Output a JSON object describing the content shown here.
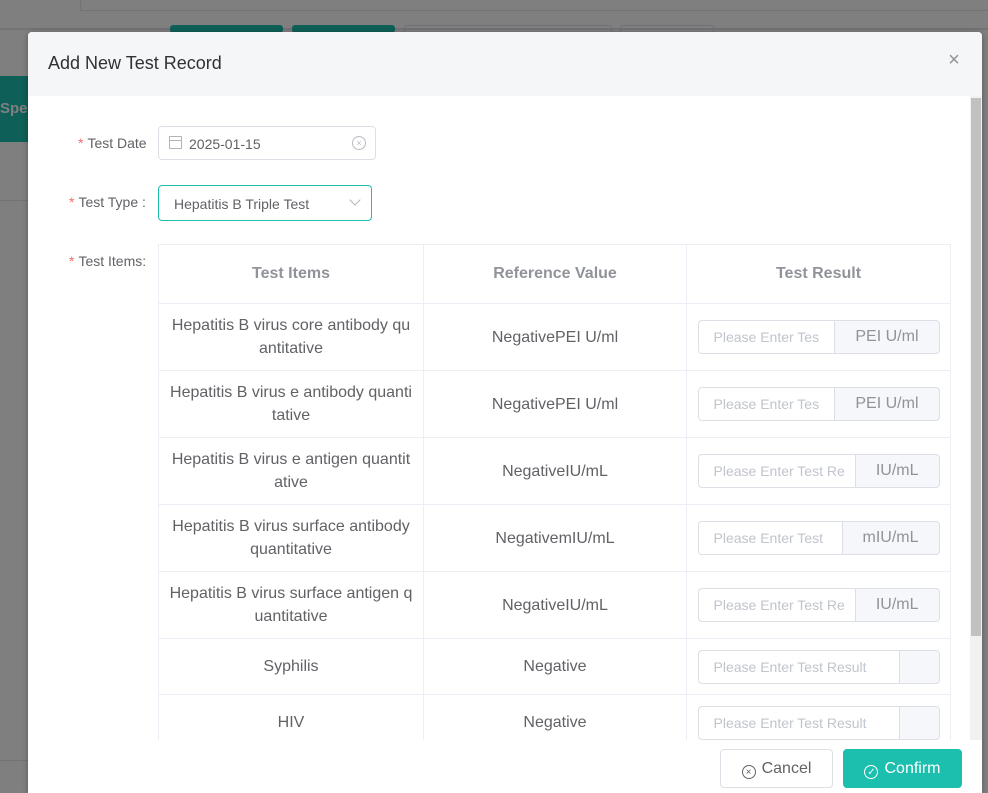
{
  "background": {
    "side_tab_label": "Spe"
  },
  "dialog": {
    "title": "Add New Test Record",
    "close_icon": "close-icon"
  },
  "form": {
    "test_date": {
      "label": "Test Date",
      "value": "2025-01-15",
      "icon": "calendar-icon",
      "clear_icon": "clear-circle-icon"
    },
    "test_type": {
      "label": "Test Type :",
      "value": "Hepatitis B Triple Test",
      "icon": "chevron-down-icon"
    },
    "test_items": {
      "label": "Test Items:",
      "columns": [
        "Test Items",
        "Reference Value",
        "Test Result"
      ],
      "rows": [
        {
          "item": "Hepatitis B virus core antibody quantitative",
          "reference": "NegativePEI U/ml",
          "placeholder": "Please Enter Tes",
          "unit": "PEI U/ml"
        },
        {
          "item": "Hepatitis B virus e antibody quantitative",
          "reference": "NegativePEI U/ml",
          "placeholder": "Please Enter Tes",
          "unit": "PEI U/ml"
        },
        {
          "item": "Hepatitis B virus e antigen quantitative",
          "reference": "NegativeIU/mL",
          "placeholder": "Please Enter Test Re",
          "unit": "IU/mL"
        },
        {
          "item": "Hepatitis B virus surface antibody quantitative",
          "reference": "NegativemIU/mL",
          "placeholder": "Please Enter Test",
          "unit": "mIU/mL"
        },
        {
          "item": "Hepatitis B virus surface antigen quantitative",
          "reference": "NegativeIU/mL",
          "placeholder": "Please Enter Test Re",
          "unit": "IU/mL"
        },
        {
          "item": "Syphilis",
          "reference": "Negative",
          "placeholder": "Please Enter Test Result",
          "unit": ""
        },
        {
          "item": "HIV",
          "reference": "Negative",
          "placeholder": "Please Enter Test Result",
          "unit": ""
        }
      ]
    }
  },
  "footer": {
    "cancel_label": "Cancel",
    "confirm_label": "Confirm"
  },
  "colors": {
    "accent": "#1cbfae",
    "required": "#f56c6c",
    "border": "#dcdfe6"
  }
}
